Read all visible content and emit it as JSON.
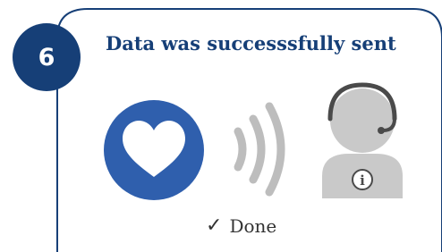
{
  "step": {
    "number": "6"
  },
  "title": "Data was successsfully sent",
  "status": {
    "check": "✓",
    "label": "Done"
  },
  "icons": {
    "heart": "heart-icon",
    "signal": "wireless-signal-icon",
    "agent": "support-agent-icon",
    "info": "info-icon"
  },
  "colors": {
    "primary": "#163F77",
    "heart_circle": "#2F5FAD",
    "signal_grey": "#BDBDBD",
    "agent_grey": "#C9C9C9",
    "headset": "#4A4A4A"
  }
}
